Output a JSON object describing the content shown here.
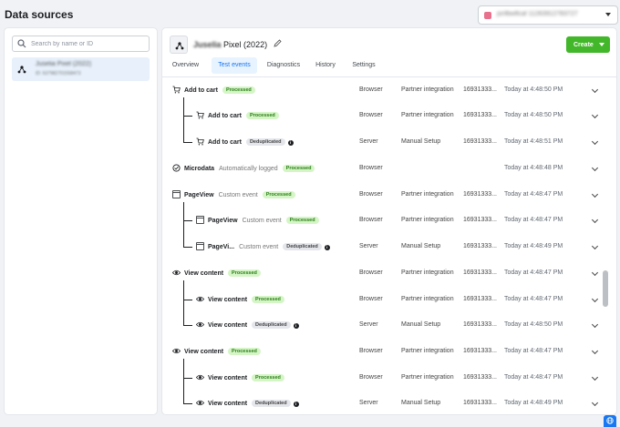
{
  "page": {
    "title": "Data sources"
  },
  "account": {
    "name": "jsnfbwflcaf 11263912783727",
    "logo_color": "#e8718d"
  },
  "sidebar": {
    "search_placeholder": "Search by name or ID",
    "source_item": {
      "name": "Juselia Pixel (2022)",
      "id": "ID: 637982701558473"
    }
  },
  "pixel": {
    "name": "Juselia",
    "year": "Pixel (2022)",
    "icon": "pixel-icon"
  },
  "toolbar": {
    "create_label": "Create",
    "create_color": "#42b72a"
  },
  "tabs": [
    {
      "label": "Overview",
      "active": false
    },
    {
      "label": "Test events",
      "active": true
    },
    {
      "label": "Diagnostics",
      "active": false
    },
    {
      "label": "History",
      "active": false
    },
    {
      "label": "Settings",
      "active": false
    }
  ],
  "events": [
    {
      "icon": "cart-icon",
      "name": "Add to cart",
      "sub": "",
      "badge": "Processed",
      "info": false,
      "source": "Browser",
      "method": "Partner integration",
      "id": "16931333...",
      "time": "Today at 4:48:50 PM",
      "child": false
    },
    {
      "icon": "cart-icon",
      "name": "Add to cart",
      "sub": "",
      "badge": "Processed",
      "info": false,
      "source": "Browser",
      "method": "Partner integration",
      "id": "16931333...",
      "time": "Today at 4:48:50 PM",
      "child": true
    },
    {
      "icon": "cart-icon",
      "name": "Add to cart",
      "sub": "",
      "badge": "Deduplicated",
      "info": true,
      "source": "Server",
      "method": "Manual Setup",
      "id": "16931333...",
      "time": "Today at 4:48:51 PM",
      "child": true
    },
    {
      "icon": "microdata-icon",
      "name": "Microdata",
      "sub": "Automatically logged",
      "badge": "Processed",
      "info": false,
      "source": "Browser",
      "method": "",
      "id": "",
      "time": "Today at 4:48:48 PM",
      "child": false
    },
    {
      "icon": "pageview-icon",
      "name": "PageView",
      "sub": "Custom event",
      "badge": "Processed",
      "info": false,
      "source": "Browser",
      "method": "Partner integration",
      "id": "16931333...",
      "time": "Today at 4:48:47 PM",
      "child": false
    },
    {
      "icon": "pageview-icon",
      "name": "PageView",
      "sub": "Custom event",
      "badge": "Processed",
      "info": false,
      "source": "Browser",
      "method": "Partner integration",
      "id": "16931333...",
      "time": "Today at 4:48:47 PM",
      "child": true
    },
    {
      "icon": "pageview-icon",
      "name": "PageVi...",
      "sub": "Custom event",
      "badge": "Deduplicated",
      "info": true,
      "source": "Server",
      "method": "Manual Setup",
      "id": "16931333...",
      "time": "Today at 4:48:49 PM",
      "child": true
    },
    {
      "icon": "eye-icon",
      "name": "View content",
      "sub": "",
      "badge": "Processed",
      "info": false,
      "source": "Browser",
      "method": "Partner integration",
      "id": "16931333...",
      "time": "Today at 4:48:47 PM",
      "child": false
    },
    {
      "icon": "eye-icon",
      "name": "View content",
      "sub": "",
      "badge": "Processed",
      "info": false,
      "source": "Browser",
      "method": "Partner integration",
      "id": "16931333...",
      "time": "Today at 4:48:47 PM",
      "child": true
    },
    {
      "icon": "eye-icon",
      "name": "View content",
      "sub": "",
      "badge": "Deduplicated",
      "info": true,
      "source": "Server",
      "method": "Manual Setup",
      "id": "16931333...",
      "time": "Today at 4:48:50 PM",
      "child": true
    },
    {
      "icon": "eye-icon",
      "name": "View content",
      "sub": "",
      "badge": "Processed",
      "info": false,
      "source": "Browser",
      "method": "Partner integration",
      "id": "16931333...",
      "time": "Today at 4:48:47 PM",
      "child": false
    },
    {
      "icon": "eye-icon",
      "name": "View content",
      "sub": "",
      "badge": "Processed",
      "info": false,
      "source": "Browser",
      "method": "Partner integration",
      "id": "16931333...",
      "time": "Today at 4:48:47 PM",
      "child": true
    },
    {
      "icon": "eye-icon",
      "name": "View content",
      "sub": "",
      "badge": "Deduplicated",
      "info": true,
      "source": "Server",
      "method": "Manual Setup",
      "id": "16931333...",
      "time": "Today at 4:48:49 PM",
      "child": true
    }
  ],
  "colors": {
    "processed_bg": "#d5f5c7",
    "processed_text": "#2a7d17",
    "accent": "#1877f2"
  }
}
